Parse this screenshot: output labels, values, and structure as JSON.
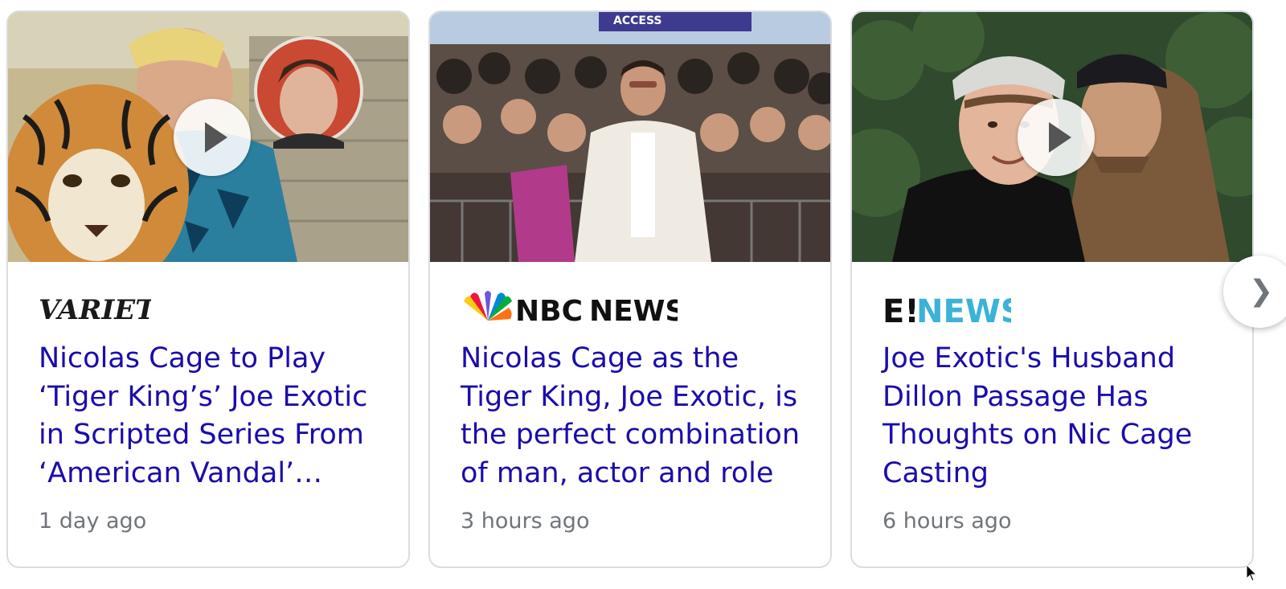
{
  "cards": [
    {
      "source": "VARIETY",
      "headline": "Nicolas Cage to Play ‘Tiger King’s’ Joe Exotic in Scripted Series From ‘American Vandal’…",
      "time": "1 day ago",
      "has_video": true
    },
    {
      "source_parts": [
        "NBC",
        "NEWS"
      ],
      "headline": "Nicolas Cage as the Tiger King, Joe Exotic, is the perfect combination of man, actor and role",
      "time": "3 hours ago",
      "has_video": false,
      "banner_text": "ACCESS"
    },
    {
      "source_parts": [
        "E!",
        "NEWS"
      ],
      "headline": "Joe Exotic's Husband Dillon Passage Has Thoughts on Nic Cage Casting",
      "time": "6 hours ago",
      "has_video": true
    }
  ],
  "next_button": {
    "icon": "chevron-right-icon"
  },
  "colors": {
    "link": "#1a0dab",
    "meta": "#70757a",
    "border": "#dadce0",
    "enews": "#3cb2d6"
  }
}
